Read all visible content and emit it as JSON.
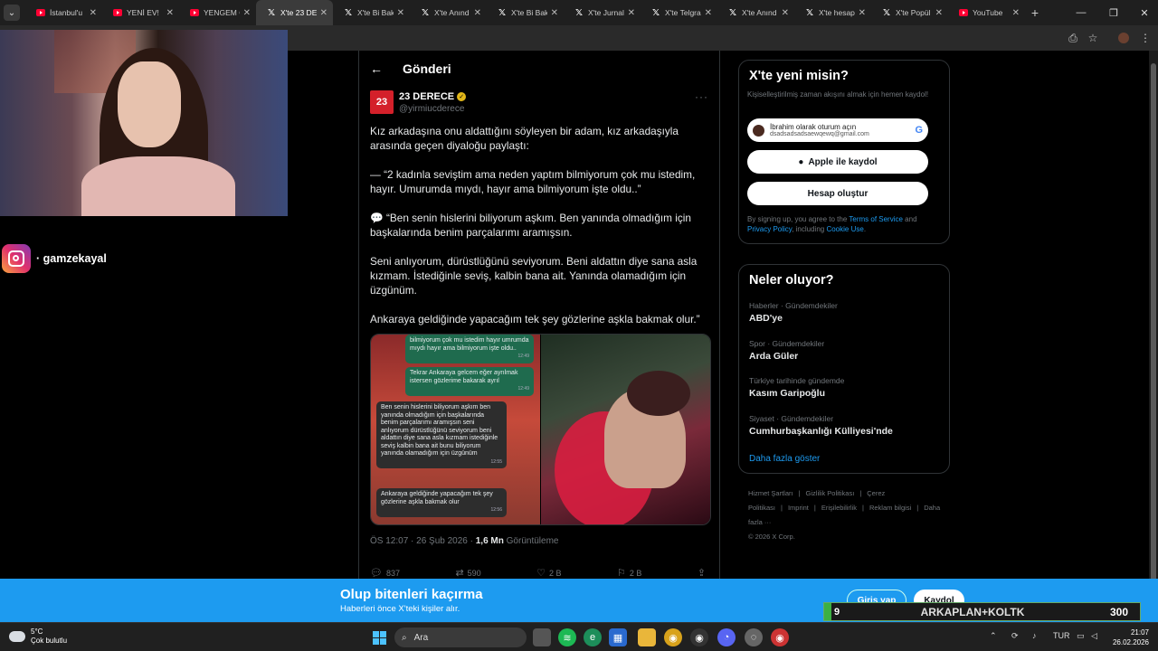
{
  "browser": {
    "tabs": [
      {
        "title": "İstanbul'u",
        "icon": "youtube-icon",
        "active": false
      },
      {
        "title": "YENİ EV!",
        "icon": "youtube-icon",
        "active": false
      },
      {
        "title": "YENGEM C",
        "icon": "youtube-icon",
        "active": false
      },
      {
        "title": "X'te 23 DE",
        "icon": "x-icon",
        "active": true
      },
      {
        "title": "X'te Bi Bak",
        "icon": "x-icon",
        "active": false
      },
      {
        "title": "X'te Anınd",
        "icon": "x-icon",
        "active": false
      },
      {
        "title": "X'te Bi Bak",
        "icon": "x-icon",
        "active": false
      },
      {
        "title": "X'te Jurnal",
        "icon": "x-icon",
        "active": false
      },
      {
        "title": "X'te Telgra",
        "icon": "x-icon",
        "active": false
      },
      {
        "title": "X'te Anınd",
        "icon": "x-icon",
        "active": false
      },
      {
        "title": "X'te hesap",
        "icon": "x-icon",
        "active": false
      },
      {
        "title": "X'te Popül",
        "icon": "x-icon",
        "active": false
      },
      {
        "title": "YouTube",
        "icon": "youtube-icon",
        "active": false
      }
    ],
    "new_tab": "+"
  },
  "stream": {
    "instagram_handle": "· gamzekayal"
  },
  "post": {
    "header_title": "Gönderi",
    "author_avatar_text": "23",
    "author_name": "23 DERECE",
    "author_handle": "@yirmiucderece",
    "more": "···",
    "paragraphs": [
      "Kız arkadaşına onu aldattığını söyleyen bir adam, kız arkadaşıyla arasında geçen diyaloğu paylaştı:",
      "— “2 kadınla seviştim ama neden yaptım bilmiyorum çok mu istedim, hayır.  Umurumda mıydı, hayır ama bilmiyorum işte oldu..”",
      "💬 “Ben senin hislerini biliyorum aşkım. Ben yanında olmadığım için başkalarında benim parçalarımı aramışsın.",
      "Seni anlıyorum, dürüstlüğünü seviyorum. Beni aldattın diye sana asla kızmam. İstediğinle seviş, kalbin bana ait. Yanında olamadığım için üzgünüm.",
      "Ankaraya geldiğinde yapacağım tek şey gözlerine aşkla bakmak olur.”"
    ],
    "chat_bubbles": [
      {
        "text": "bilmiyorum çok mu istedim hayır umrumda mıydı hayır ama bilmiyorum işte oldu..",
        "time": "12:49",
        "type": "out"
      },
      {
        "text": "Tekrar Ankaraya gelcem eğer ayrılmak istersen gözlerime bakarak ayrıl",
        "time": "12:49",
        "type": "out"
      },
      {
        "text": "Ben senin hislerini biliyorum aşkım ben yanında olmadığım için başkalarında benim parçalarımı aramışsın seni anlıyorum dürüstlüğünü seviyorum beni aldattın diye sana asla kızmam istediğinle seviş kalbin bana ait bunu biliyorum yanında olamadığım için üzgünüm",
        "time": "12:55",
        "type": "in"
      },
      {
        "text": "Ankaraya geldiğinde yapacağım tek şey gözlerine aşkla bakmak olur",
        "time": "12:56",
        "type": "in"
      }
    ],
    "time": "ÖS 12:07 · 26 Şub 2026 · ",
    "views_count": "1,6 Mn",
    "views_label": " Görüntüleme",
    "replies": "837",
    "reposts": "590",
    "likes": "2 B",
    "bookmarks": "2 B"
  },
  "signup": {
    "title": "X'te yeni misin?",
    "subtitle": "Kişiselleştirilmiş zaman akışını almak için hemen kaydol!",
    "google_line1": "İbrahim olarak oturum açın",
    "google_line2": "dsadsadsadsaewqewq@gmail.com",
    "google_logo": "G",
    "apple_label": "Apple ile kaydol",
    "create_label": "Hesap oluştur",
    "terms_prefix": "By signing up, you agree to the ",
    "terms_link": "Terms of Service",
    "terms_and": " and ",
    "privacy_link": "Privacy Policy",
    "including": ", including ",
    "cookie_link": "Cookie Use",
    "terms_end": "."
  },
  "trends": {
    "title": "Neler oluyor?",
    "items": [
      {
        "category": "Haberler · Gündemdekiler",
        "name": "ABD'ye"
      },
      {
        "category": "Spor · Gündemdekiler",
        "name": "Arda Güler"
      },
      {
        "category": "Türkiye tarihinde gündemde",
        "name": "Kasım Garipoğlu"
      },
      {
        "category": "Siyaset · Gündemdekiler",
        "name": "Cumhurbaşkanlığı Külliyesi'nde"
      }
    ],
    "show_more": "Daha fazla göster"
  },
  "footer": {
    "links": [
      "Hizmet Şartları",
      "|",
      "Gizlilik Politikası",
      "|",
      "Çerez Politikası",
      "|",
      "Imprint",
      "|",
      "Erişilebilirlik",
      "|",
      "Reklam bilgisi",
      "|",
      "Daha fazla ···"
    ],
    "copyright": "© 2026 X Corp."
  },
  "banner": {
    "title": "Olup bitenleri kaçırma",
    "subtitle": "Haberleri önce X'teki kişiler alır.",
    "login": "Giriş yap",
    "register": "Kaydol"
  },
  "overlay": {
    "number": "9",
    "title": "ARKAPLAN+KOLTK",
    "value": "300"
  },
  "taskbar": {
    "temp": "5°C",
    "condition": "Çok bulutlu",
    "search_placeholder": "Ara",
    "lang": "TUR",
    "time": "21:07",
    "date": "26.02.2026"
  }
}
